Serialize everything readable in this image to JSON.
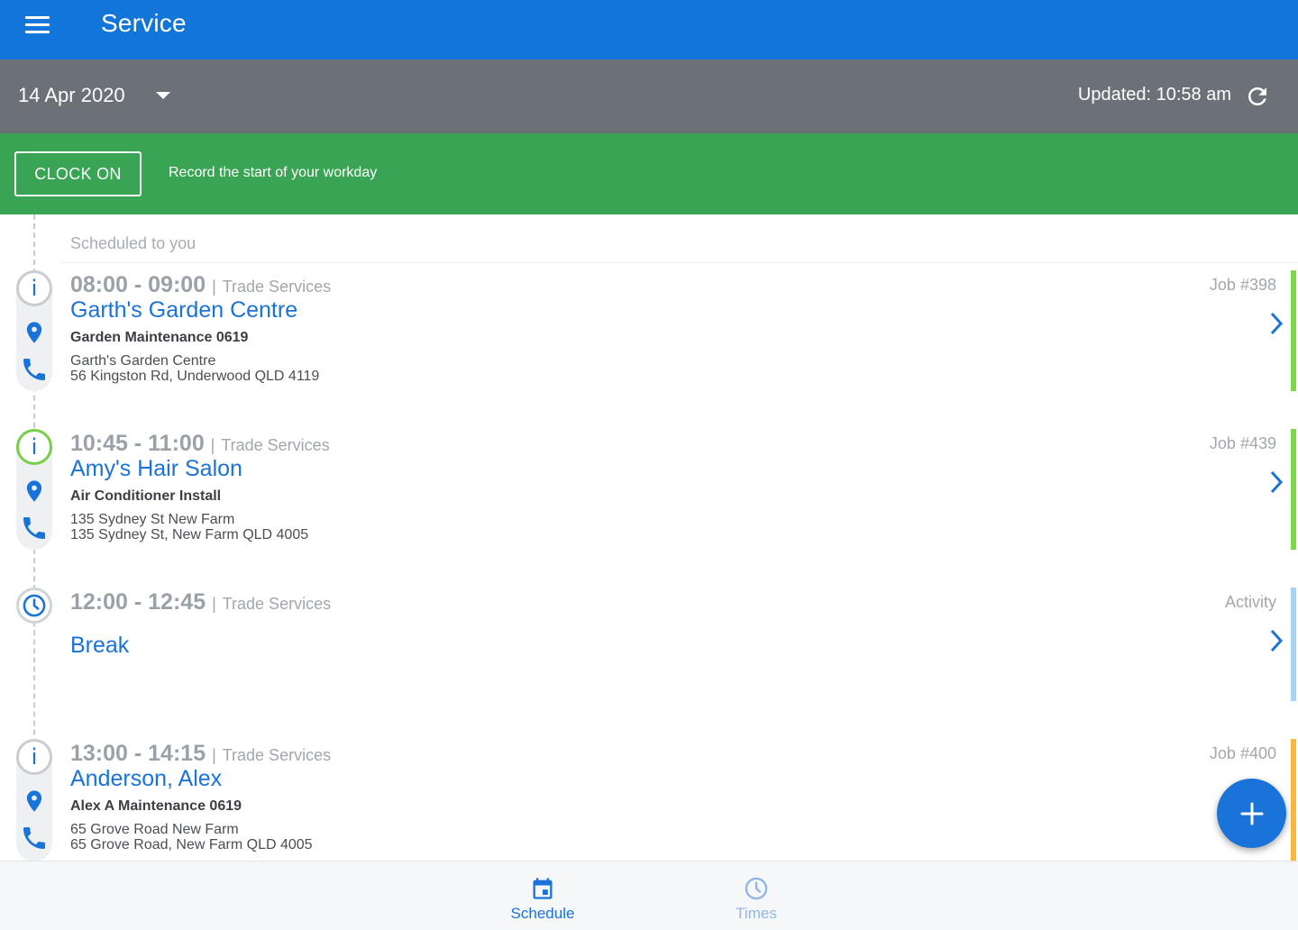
{
  "appbar": {
    "title": "Service"
  },
  "datebar": {
    "date": "14 Apr 2020",
    "updated": "Updated: 10:58 am"
  },
  "clockbar": {
    "button_label": "CLOCK ON",
    "description": "Record the start of your workday"
  },
  "schedule": {
    "section_label": "Scheduled to you",
    "items": [
      {
        "time": "08:00 - 09:00",
        "service": "Trade Services",
        "client": "Garth's Garden Centre",
        "title": "Garden Maintenance 0619",
        "address_line1": "Garth's Garden Centre",
        "address_line2": "56 Kingston Rd, Underwood QLD 4119",
        "job": "Job #398",
        "status_color": "#7ed64a",
        "icon": "info-icon"
      },
      {
        "time": "10:45 - 11:00",
        "service": "Trade Services",
        "client": "Amy's Hair Salon",
        "title": "Air Conditioner Install",
        "address_line1": "135 Sydney St New Farm",
        "address_line2": "135 Sydney St, New Farm QLD 4005",
        "job": "Job #439",
        "status_color": "#7ed64a",
        "icon": "info-icon"
      },
      {
        "time": "12:00 - 12:45",
        "service": "Trade Services",
        "client": "Break",
        "job": "Activity",
        "status_color": "#a9d3f5",
        "icon": "clock-icon"
      },
      {
        "time": "13:00 - 14:15",
        "service": "Trade Services",
        "client": "Anderson, Alex",
        "title": "Alex A Maintenance 0619",
        "address_line1": "65 Grove Road New Farm",
        "address_line2": "65 Grove Road, New Farm QLD 4005",
        "job": "Job #400",
        "status_color": "#f7b840",
        "icon": "info-icon"
      }
    ]
  },
  "bottomnav": {
    "items": [
      {
        "label": "Schedule",
        "active": true,
        "icon": "calendar-icon"
      },
      {
        "label": "Times",
        "active": false,
        "icon": "clock-icon"
      }
    ]
  },
  "colors": {
    "primary": "#1275d9",
    "accent_blue": "#1a73d8",
    "clock_green": "#3aa455",
    "datebar_grey": "#6c7077"
  }
}
